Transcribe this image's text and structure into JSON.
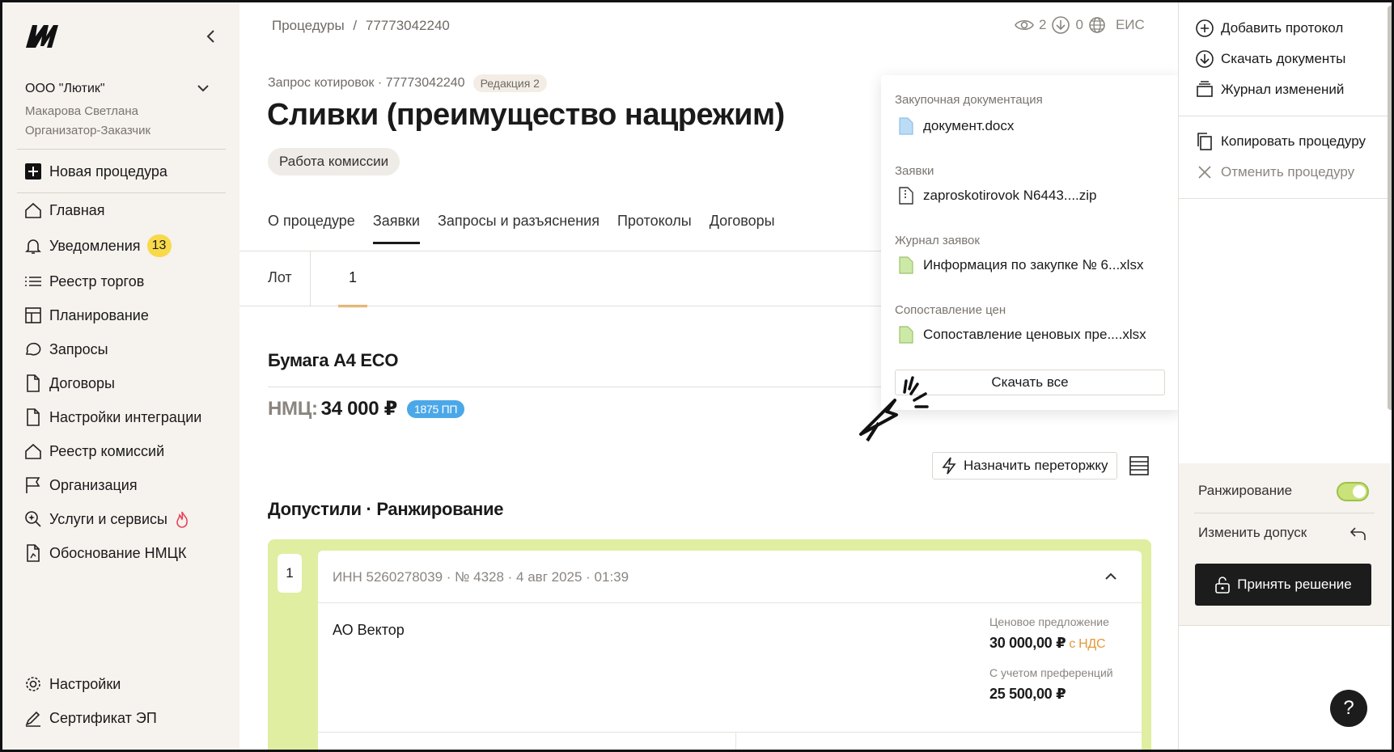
{
  "sidebar": {
    "org_name": "ООО \"Лютик\"",
    "user_name": "Макарова Светлана",
    "user_role": "Организатор-Заказчик",
    "new_procedure": "Новая процедура",
    "items": [
      {
        "label": "Главная",
        "icon": "home-icon"
      },
      {
        "label": "Уведомления",
        "icon": "bell-icon",
        "badge": "13"
      },
      {
        "label": "Реестр торгов",
        "icon": "list-icon"
      },
      {
        "label": "Планирование",
        "icon": "layout-icon"
      },
      {
        "label": "Запросы",
        "icon": "chat-icon"
      },
      {
        "label": "Договоры",
        "icon": "document-icon"
      },
      {
        "label": "Настройки интеграции",
        "icon": "document-icon"
      },
      {
        "label": "Реестр комиссий",
        "icon": "home-icon"
      },
      {
        "label": "Организация",
        "icon": "flag-icon"
      },
      {
        "label": "Услуги и сервисы",
        "icon": "sparkle-search-icon"
      },
      {
        "label": "Обоснование НМЦК",
        "icon": "document-chart-icon"
      }
    ],
    "footer": [
      {
        "label": "Настройки",
        "icon": "gear-icon"
      },
      {
        "label": "Сертификат ЭП",
        "icon": "signature-icon"
      }
    ]
  },
  "header": {
    "breadcrumb_root": "Процедуры",
    "breadcrumb_sep": "/",
    "breadcrumb_current": "77773042240",
    "views": "2",
    "downloads": "0",
    "eis": "ЕИС"
  },
  "procedure": {
    "subtitle": "Запрос котировок · 77773042240",
    "revision": "Редакция 2",
    "title": "Сливки (преимущество нацрежим)",
    "status": "Работа комиссии"
  },
  "tabs": [
    {
      "label": "О процедуре"
    },
    {
      "label": "Заявки",
      "active": true
    },
    {
      "label": "Запросы и разъяснения"
    },
    {
      "label": "Протоколы"
    },
    {
      "label": "Договоры"
    }
  ],
  "lot": {
    "label": "Лот",
    "number": "1"
  },
  "item": {
    "title": "Бумага А4 ECO",
    "nmc_label": "НМЦ:",
    "nmc_value": "34 000 ₽",
    "pp_badge": "1875 ПП"
  },
  "retender_button": "Назначить переторжку",
  "section_title": "Допустили · Ранжирование",
  "application": {
    "rank": "1",
    "header": "ИНН 5260278039 · № 4328 · 4 авг 2025 · 01:39",
    "supplier": "АО Вектор",
    "price_label": "Ценовое предложение",
    "price_value": "30 000,00 ₽",
    "price_vat": "с НДС",
    "pref_label": "С учетом преференций",
    "pref_value": "25 500,00 ₽"
  },
  "downloads_menu": {
    "groups": [
      {
        "title": "Закупочная документация",
        "file": "документ.docx",
        "icon": "doc-file-icon",
        "color": "#bcdcf5"
      },
      {
        "title": "Заявки",
        "file": "zaproskotirovok N6443....zip",
        "icon": "zip-file-icon",
        "color": "#ffffff"
      },
      {
        "title": "Журнал заявок",
        "file": "Информация по закупке № 6...xlsx",
        "icon": "xlsx-file-icon",
        "color": "#cde9a8"
      },
      {
        "title": "Сопоставление цен",
        "file": "Сопоставление ценовых пре....xlsx",
        "icon": "xlsx-file-icon",
        "color": "#cde9a8"
      }
    ],
    "download_all": "Скачать все"
  },
  "right_panel": {
    "actions": [
      {
        "label": "Добавить протокол",
        "icon": "plus-circle-icon"
      },
      {
        "label": "Скачать документы",
        "icon": "download-circle-icon"
      },
      {
        "label": "Журнал изменений",
        "icon": "archive-icon"
      }
    ],
    "actions2": [
      {
        "label": "Копировать процедуру",
        "icon": "copy-icon"
      },
      {
        "label": "Отменить процедуру",
        "icon": "close-icon",
        "muted": true
      }
    ],
    "ranking_label": "Ранжирование",
    "change_admission": "Изменить допуск",
    "decide_button": "Принять решение"
  },
  "help": "?"
}
